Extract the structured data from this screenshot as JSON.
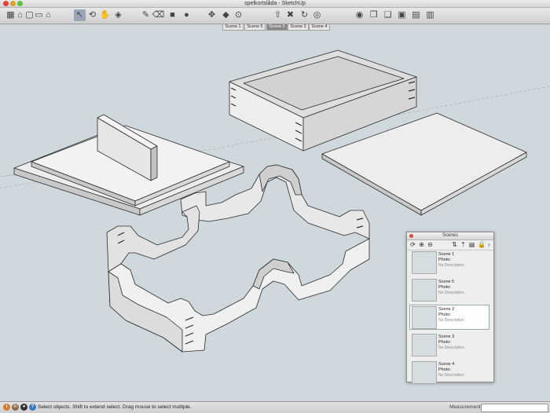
{
  "window": {
    "title": "spelkortslåda - SketchUp"
  },
  "toolbar": {
    "tools": [
      {
        "icon": "standard-views-icon",
        "glyph": "▦"
      },
      {
        "icon": "home-icon",
        "glyph": "⌂"
      },
      {
        "icon": "view-top-icon",
        "glyph": "▢"
      },
      {
        "icon": "view-front-icon",
        "glyph": "▭"
      },
      {
        "icon": "view-house-icon",
        "glyph": "⌂"
      },
      {
        "icon": "select-arrow-icon",
        "glyph": "↖"
      },
      {
        "icon": "orbit-icon",
        "glyph": "⟲"
      },
      {
        "icon": "pan-hand-icon",
        "glyph": "✋"
      },
      {
        "icon": "zoom-extents-icon",
        "glyph": "◈"
      },
      {
        "icon": "pencil-icon",
        "glyph": "✎"
      },
      {
        "icon": "eraser-icon",
        "glyph": "⌫"
      },
      {
        "icon": "rectangle-icon",
        "glyph": "■"
      },
      {
        "icon": "circle-icon",
        "glyph": "●"
      },
      {
        "icon": "move-icon",
        "glyph": "✥"
      },
      {
        "icon": "paint-bucket-icon",
        "glyph": "◆"
      },
      {
        "icon": "tape-measure-icon",
        "glyph": "⊙"
      },
      {
        "icon": "push-pull-icon",
        "glyph": "⇧"
      },
      {
        "icon": "scale-icon",
        "glyph": "✖"
      },
      {
        "icon": "rotate-icon",
        "glyph": "↻"
      },
      {
        "icon": "offset-icon",
        "glyph": "◎"
      },
      {
        "icon": "model-info-icon",
        "glyph": "◉"
      },
      {
        "icon": "components-icon",
        "glyph": "❐"
      },
      {
        "icon": "styles-icon",
        "glyph": "❏"
      },
      {
        "icon": "layers-icon",
        "glyph": "▣"
      },
      {
        "icon": "outliner-icon",
        "glyph": "▤"
      },
      {
        "icon": "scenes-icon",
        "glyph": "▥"
      }
    ]
  },
  "scene_tabs": [
    {
      "label": "Scene 1",
      "active": false
    },
    {
      "label": "Scene 5",
      "active": false
    },
    {
      "label": "Scene 2",
      "active": true
    },
    {
      "label": "Scene 3",
      "active": false
    },
    {
      "label": "Scene 4",
      "active": false
    }
  ],
  "status": {
    "text": "Select objects. Shift to extend select. Drag mouse to select multiple.",
    "measurements_label": "Measurements",
    "measurements_value": ""
  },
  "scenes_panel": {
    "title": "Scenes",
    "items": [
      {
        "name": "Scene 1",
        "photo": "Photo:",
        "desc": "No Description",
        "selected": false
      },
      {
        "name": "Scene 5",
        "photo": "Photo:",
        "desc": "No Description",
        "selected": false
      },
      {
        "name": "Scene 2",
        "photo": "Photo:",
        "desc": "No Description",
        "selected": true
      },
      {
        "name": "Scene 3",
        "photo": "Photo:",
        "desc": "No Description",
        "selected": false
      },
      {
        "name": "Scene 4",
        "photo": "Photo:",
        "desc": "No Description",
        "selected": false
      }
    ]
  },
  "colors": {
    "viewport_bg": "#cfd8dc",
    "model_face": "#ededed",
    "model_side": "#c9c9c9",
    "model_edge": "#2b2b2b"
  }
}
